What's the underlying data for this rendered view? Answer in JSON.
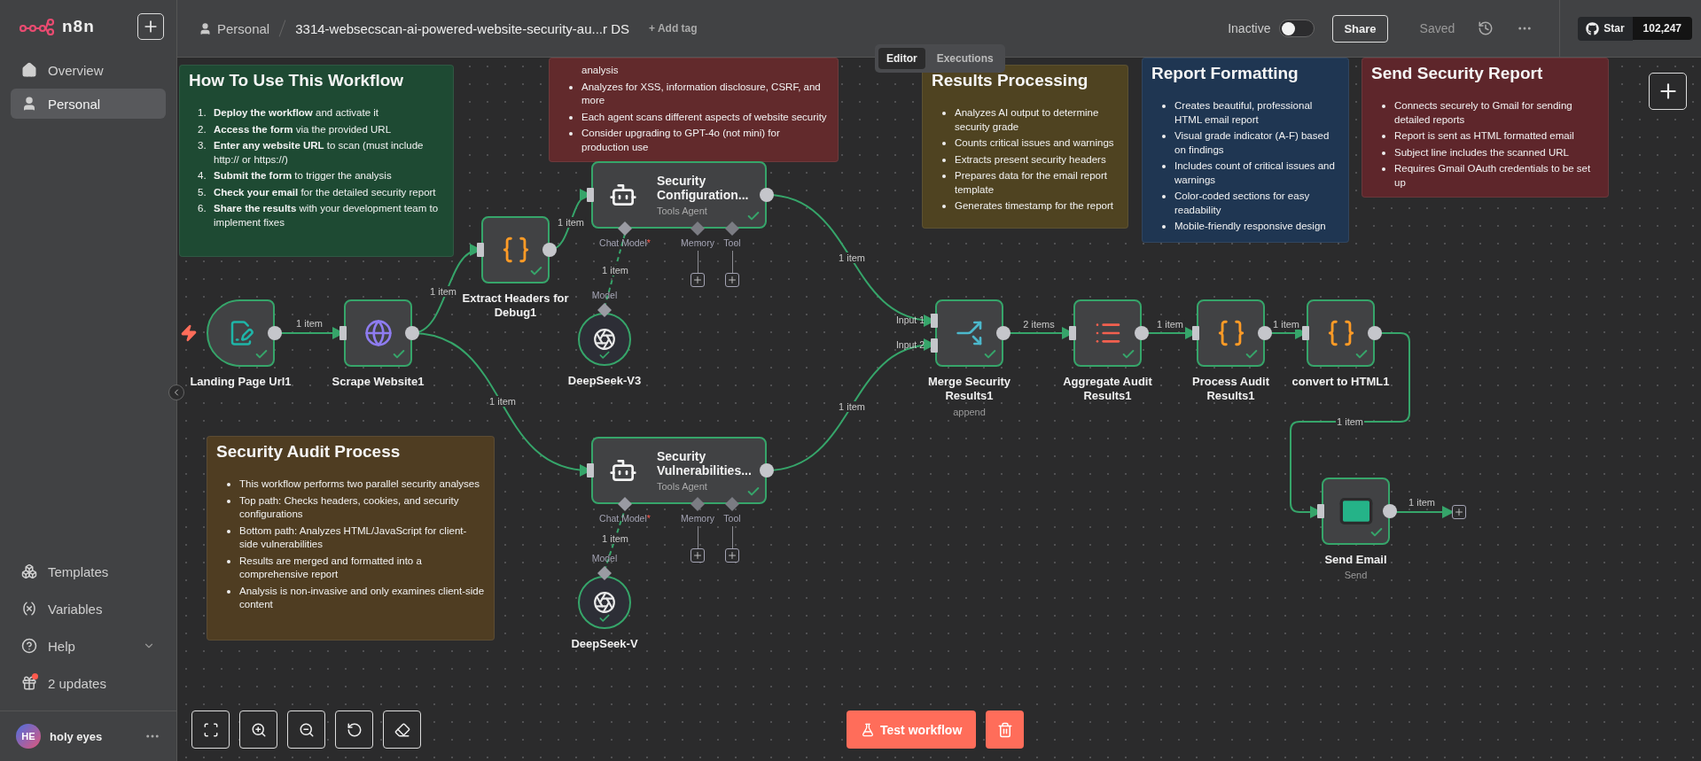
{
  "sidebar": {
    "logo": "n8n",
    "items": [
      {
        "label": "Overview",
        "selected": false
      },
      {
        "label": "Personal",
        "selected": true
      }
    ],
    "bottom_items": [
      {
        "label": "Templates"
      },
      {
        "label": "Variables"
      },
      {
        "label": "Help",
        "expandable": true
      },
      {
        "label": "2 updates",
        "badge": true
      }
    ],
    "user": {
      "initials": "HE",
      "name": "holy eyes"
    }
  },
  "header": {
    "project": "Personal",
    "title": "3314-websecscan-ai-powered-website-security-au...r DS",
    "add_tag": "+ Add tag",
    "status": "Inactive",
    "active": false,
    "share": "Share",
    "saved": "Saved",
    "github": {
      "label": "Star",
      "count": "102,247"
    }
  },
  "view_tabs": [
    {
      "label": "Editor",
      "selected": true
    },
    {
      "label": "Executions",
      "selected": false
    }
  ],
  "notes": [
    {
      "color": "#622a2c",
      "first_item_cut": true,
      "items": [
        {
          "text": "analysis"
        },
        {
          "text": "Analyzes for XSS, information disclosure, CSRF, and more"
        },
        {
          "text": "Each agent scans different aspects of website security"
        },
        {
          "text": "Consider upgrading to GPT-4o (not mini) for production use"
        }
      ]
    },
    {
      "title": "How To Use This Workflow",
      "color": "#1e4a33",
      "ordered": true,
      "items": [
        {
          "number": "1.",
          "text": "**Deploy the workflow** and activate it"
        },
        {
          "number": "2.",
          "text": "**Access the form** via the provided URL"
        },
        {
          "number": "3.",
          "text": "**Enter any website URL** to scan (must include http:// or https://)"
        },
        {
          "number": "4.",
          "text": "**Submit the form** to trigger the analysis"
        },
        {
          "number": "5.",
          "text": "**Check your email** for the detailed security report"
        },
        {
          "number": "6.",
          "text": "**Share the results** with your development team to implement fixes"
        }
      ]
    },
    {
      "title": "Results Processing",
      "color": "#4f4321",
      "items": [
        {
          "text": "Analyzes AI output to determine security grade"
        },
        {
          "text": "Counts critical issues and warnings"
        },
        {
          "text": "Extracts present security headers"
        },
        {
          "text": "Prepares data for the email report template"
        },
        {
          "text": "Generates timestamp for the report"
        }
      ]
    },
    {
      "title": "Report Formatting",
      "color": "#1f3652",
      "items": [
        {
          "text": "Creates beautiful, professional HTML email report"
        },
        {
          "text": "Visual grade indicator (A-F) based on findings"
        },
        {
          "text": "Includes count of critical issues and warnings"
        },
        {
          "text": "Color-coded sections for easy readability"
        },
        {
          "text": "Mobile-friendly responsive design"
        }
      ]
    },
    {
      "title": "Send Security Report",
      "color": "#5e262b",
      "items": [
        {
          "text": "Connects securely to Gmail for sending detailed reports"
        },
        {
          "text": "Report is sent as HTML formatted email"
        },
        {
          "text": "Subject line includes the scanned URL"
        },
        {
          "text": "Requires Gmail OAuth credentials to be set up"
        }
      ]
    },
    {
      "title": "Security Audit Process",
      "color": "#4f3d22",
      "items": [
        {
          "text": "This workflow performs two parallel security analyses"
        },
        {
          "text": "Top path: Checks headers, cookies, and security configurations"
        },
        {
          "text": "Bottom path: Analyzes HTML/JavaScript for client-side vulnerabilities"
        },
        {
          "text": "Results are merged and formatted into a comprehensive report"
        },
        {
          "text": "Analysis is non-invasive and only examines client-side content"
        }
      ]
    }
  ],
  "nodes": [
    {
      "kind": "trigger",
      "name": "Landing Page Url1",
      "success": true
    },
    {
      "kind": "http",
      "name": "Scrape Website1",
      "success": true
    },
    {
      "kind": "code",
      "name": "Extract Headers for Debug1",
      "success": true
    },
    {
      "kind": "agent",
      "name": "Security Configuration...",
      "subtitle": "Tools Agent",
      "success": true,
      "ports": [
        {
          "label": "Chat Model",
          "required_mark": "*",
          "connected": true
        },
        {
          "label": "Memory",
          "connected": false
        },
        {
          "label": "Tool",
          "connected": false
        }
      ]
    },
    {
      "kind": "model",
      "name": "DeepSeek-V3",
      "input_label": "Model",
      "success": true
    },
    {
      "kind": "agent",
      "name": "Security Vulnerabilities...",
      "subtitle": "Tools Agent",
      "success": true,
      "ports": [
        {
          "label": "Chat Model",
          "required_mark": "*",
          "connected": true
        },
        {
          "label": "Memory",
          "connected": false
        },
        {
          "label": "Tool",
          "connected": false
        }
      ]
    },
    {
      "kind": "model",
      "name": "DeepSeek-V",
      "input_label": "Model",
      "success": true
    },
    {
      "kind": "merge",
      "name": "Merge Security Results1",
      "subtitle": "append",
      "inputs": [
        "Input 1",
        "Input 2"
      ],
      "success": true
    },
    {
      "kind": "aggregate",
      "name": "Aggregate Audit Results1",
      "success": true
    },
    {
      "kind": "code",
      "name": "Process Audit Results1",
      "success": true
    },
    {
      "kind": "code",
      "name": "convert to HTML1",
      "success": true
    },
    {
      "kind": "email",
      "name": "Send Email",
      "subtitle": "Send",
      "success": true
    }
  ],
  "edges": [
    {
      "kind": "main",
      "label": "1 item"
    },
    {
      "kind": "main",
      "label": "1 item"
    },
    {
      "kind": "main",
      "label": "1 item"
    },
    {
      "kind": "main",
      "label": "1 item"
    },
    {
      "kind": "main",
      "label": "1 item"
    },
    {
      "kind": "main",
      "label": "1 item"
    },
    {
      "kind": "main",
      "label": "2 items"
    },
    {
      "kind": "main",
      "label": "1 item"
    },
    {
      "kind": "main",
      "label": "1 item"
    },
    {
      "kind": "main",
      "label": "1 item"
    },
    {
      "kind": "end",
      "label": "1 item"
    },
    {
      "kind": "ai",
      "label": "1 item"
    },
    {
      "kind": "ai",
      "label": "1 item"
    }
  ],
  "test_button": "Test workflow"
}
